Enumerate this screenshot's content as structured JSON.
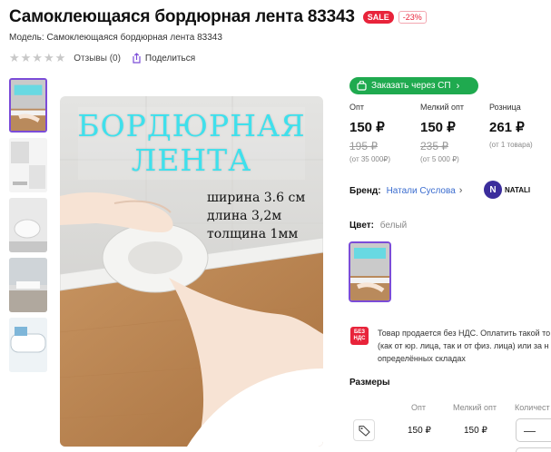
{
  "product": {
    "title": "Самоклеющаяся бордюрная лента 83343",
    "sale_badge": "SALE",
    "discount": "-23%",
    "model": "Модель: Самоклеющаяся бордюрная лента 83343",
    "stars": "★★★★★",
    "reviews": "Отзывы (0)",
    "share": "Поделиться"
  },
  "image": {
    "title_line1": "БОРДЮРНАЯ",
    "title_line2": "ЛЕНТА",
    "spec1": "ширина 3.6 см",
    "spec2": "длина 3,2м",
    "spec3": "толщина 1мм"
  },
  "order": {
    "label": "Заказать через СП",
    "chevron": "›"
  },
  "prices": [
    {
      "header": "Опт",
      "price": "150 ₽",
      "old": "195 ₽",
      "cond": "(от 35 000₽)"
    },
    {
      "header": "Мелкий опт",
      "price": "150 ₽",
      "old": "235 ₽",
      "cond": "(от 5 000 ₽)"
    },
    {
      "header": "Розница",
      "price": "261 ₽",
      "old": "",
      "cond": "(от 1 товара)"
    }
  ],
  "brand": {
    "label": "Бренд:",
    "value": "Натали Суслова",
    "chevron": "›",
    "logo_letter": "N",
    "logo_text": "NATALI"
  },
  "color": {
    "label": "Цвет:",
    "value": "белый"
  },
  "vat": {
    "icon_text1": "БЕЗ",
    "icon_text2": "НДС",
    "line1": "Товар продается без НДС. Оплатить такой то",
    "line2": "(как от юр. лица, так и от физ. лица) или за н",
    "line3": "определённых складах"
  },
  "sizes": {
    "title": "Размеры",
    "headers": [
      "Опт",
      "Мелкий опт",
      "Количест"
    ],
    "row": {
      "opt": "150 ₽",
      "small_opt": "150 ₽",
      "qty_minus": "—"
    }
  },
  "colors": {
    "accent_purple": "#7b4cd8",
    "sale_red": "#e8233a",
    "order_green": "#1faa4f",
    "link_blue": "#3a6ccf",
    "image_title_cyan": "#3fe0ec"
  }
}
